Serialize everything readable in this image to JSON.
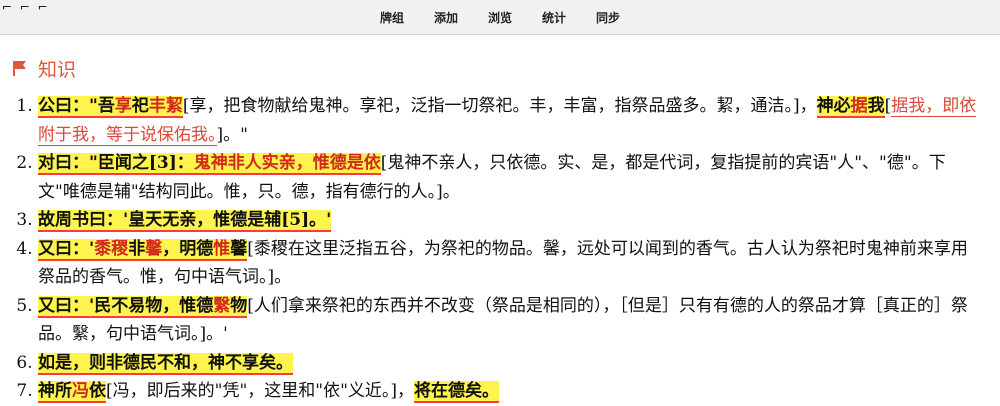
{
  "nav": [
    "牌组",
    "添加",
    "浏览",
    "统计",
    "同步"
  ],
  "corner": "⌐ ⌐ ⌐",
  "section_title": "知识",
  "items": [
    {
      "parts": [
        {
          "t": "hl",
          "s": [
            [
              "公曰：\"吾",
              ""
            ],
            [
              "享",
              "red"
            ],
            [
              "祀",
              ""
            ],
            [
              "丰絜",
              "red"
            ]
          ]
        },
        {
          "t": "note",
          "s": "[享，把食物献给鬼神。享祀，泛指一切祭祀。丰，丰富，指祭品盛多。絜，通洁。]，"
        },
        {
          "t": "hl",
          "s": [
            [
              "神必",
              ""
            ],
            [
              "据",
              "red"
            ]
          ]
        },
        {
          "t": "hl",
          "s": [
            [
              "我",
              ""
            ]
          ]
        },
        {
          "t": "note",
          "s": "["
        },
        {
          "t": "note-red",
          "s": "据我，即依附于我，等于说保佑我。"
        },
        {
          "t": "note",
          "s": "]。\""
        }
      ]
    },
    {
      "parts": [
        {
          "t": "hl",
          "s": [
            [
              "对曰：\"臣闻之",
              ""
            ],
            [
              "[3]",
              ""
            ],
            [
              "：",
              ""
            ],
            [
              "鬼神非人实亲，惟德是依",
              "red"
            ]
          ]
        },
        {
          "t": "note",
          "s": "[鬼神不亲人，只依德。实、是，都是代词，复指提前的宾语\"人\"、\"德\"。下文\"唯德是辅\"结构同此。惟，只。德，指有德行的人。]。"
        }
      ]
    },
    {
      "parts": [
        {
          "t": "hl",
          "s": [
            [
              "故周书曰：'皇天无亲，惟德是辅",
              ""
            ],
            [
              "[5]",
              ""
            ],
            [
              "。'",
              ""
            ]
          ]
        }
      ]
    },
    {
      "parts": [
        {
          "t": "hl",
          "s": [
            [
              "又曰：'",
              ""
            ],
            [
              "黍稷",
              "red"
            ],
            [
              "非",
              ""
            ],
            [
              "馨",
              "red"
            ],
            [
              "，明德",
              ""
            ],
            [
              "惟",
              "red"
            ],
            [
              "馨",
              ""
            ]
          ]
        },
        {
          "t": "note",
          "s": "[黍稷在这里泛指五谷，为祭祀的物品。馨，远处可以闻到的香气。古人认为祭祀时鬼神前来享用祭品的香气。惟，句中语气词。]。"
        }
      ]
    },
    {
      "parts": [
        {
          "t": "hl",
          "s": [
            [
              "又曰：'民不易物，惟德",
              ""
            ],
            [
              "繄",
              "red"
            ],
            [
              "物",
              ""
            ]
          ]
        },
        {
          "t": "note",
          "s": "[人们拿来祭祀的东西并不改变（祭品是相同的），［但是］只有有德的人的祭品才算［真正的］祭品。繄，句中语气词。]。'"
        }
      ]
    },
    {
      "parts": [
        {
          "t": "hl",
          "s": [
            [
              "如是，则非德民不和，神不享矣。",
              ""
            ]
          ]
        }
      ]
    },
    {
      "parts": [
        {
          "t": "hl",
          "s": [
            [
              "神所",
              ""
            ],
            [
              "冯",
              "red"
            ],
            [
              "依",
              ""
            ]
          ]
        },
        {
          "t": "note",
          "s": "[冯，即后来的\"凭\"，这里和\"依\"义近。]，"
        },
        {
          "t": "hl",
          "s": [
            [
              "将在德矣。",
              ""
            ]
          ]
        }
      ]
    }
  ]
}
